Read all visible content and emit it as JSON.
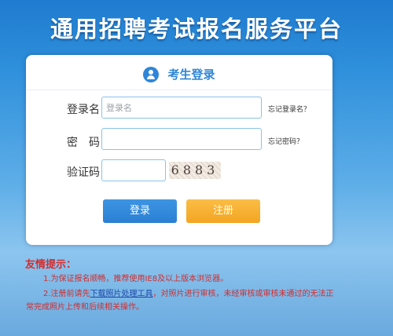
{
  "header": {
    "title": "通用招聘考试报名服务平台"
  },
  "login": {
    "title": "考生登录",
    "username_label": "登录名",
    "username_placeholder": "登录名",
    "forgot_username": "忘记登录名？",
    "password_label": "密　码",
    "forgot_password": "忘记密码？",
    "captcha_label": "验证码",
    "captcha_code": "6883",
    "login_button": "登录",
    "register_button": "注册"
  },
  "notice": {
    "title": "友情提示：",
    "item1": "1.为保证报名顺畅，推荐使用IE8及以上版本浏览器。",
    "item2_prefix": "2.注册前请先",
    "item2_link": "下载照片处理工具",
    "item2_suffix": "，对照片进行审核，未经审核或审核未通过的无法正",
    "item2_cont": "常完成照片上传和后续相关操作。"
  }
}
